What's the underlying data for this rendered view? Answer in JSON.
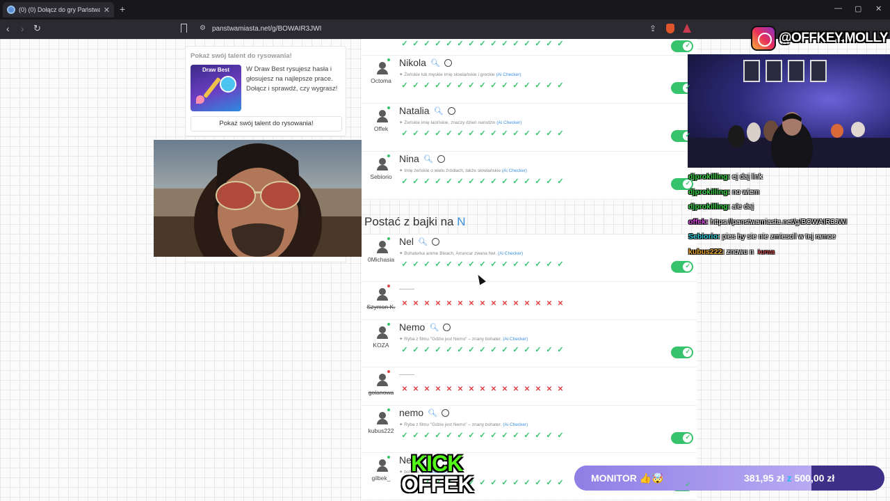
{
  "browser": {
    "tab_title": "(0) (0) Dołącz do gry Państwa M",
    "tab_close": "✕",
    "new_tab": "+",
    "url": "panstwamiasta.net/g/BOWAIR3JWI",
    "window_controls": [
      "—",
      "▢",
      "✕"
    ]
  },
  "promo": {
    "heading": "Pokaż swój talent do rysowania!",
    "tile_label": "Draw Best",
    "text": "W Draw Best rysujesz hasła i głosujesz na najlepsze prace. Dołącz i sprawdź, czy wygrasz!",
    "button": "Pokaż swój talent do rysowania!"
  },
  "results_top": [
    {
      "user": "Octoma",
      "answer": "Nikola",
      "desc": "Żeńskie lub męskie imię słowiańskie i greckie",
      "ai": "(Ai Checker)",
      "valid": true
    },
    {
      "user": "Offek",
      "answer": "Natalia",
      "desc": "Żeńskie imię łacińskie, znaczy dzień narodzin",
      "ai": "(Ai Checker)",
      "valid": true
    },
    {
      "user": "Sebiorio",
      "answer": "Nina",
      "desc": "Imię żeńskie o wielu źródłach, także słowiańskie",
      "ai": "(Ai Checker)",
      "valid": true
    }
  ],
  "category": {
    "label": "Postać z bajki na",
    "letter": "N"
  },
  "results_bottom": [
    {
      "user": "0Michasia",
      "answer": "Nel",
      "desc": "Bohaterka anime Bleach, Arrancar zwana Nel.",
      "ai": "(Ai Checker)",
      "valid": true
    },
    {
      "user": "Szymon K.",
      "answer": "",
      "desc": "",
      "ai": "",
      "valid": false
    },
    {
      "user": "KOZA",
      "answer": "Nemo",
      "desc": "Ryba z filmu \"Gdzie jest Nemo\" – znany bohater.",
      "ai": "(Ai Checker)",
      "valid": true
    },
    {
      "user": "golanowa",
      "answer": "",
      "desc": "",
      "ai": "",
      "valid": false
    },
    {
      "user": "kubus222",
      "answer": "nemo",
      "desc": "Ryba z filmu \"Gdzie jest Nemo\" – znany bohater.",
      "ai": "(Ai Checker)",
      "valid": true
    },
    {
      "user": "gilbek_",
      "answer": "Ne",
      "desc": "bohater.",
      "ai": "(Ai Checker)",
      "valid": true
    }
  ],
  "instagram": {
    "handle": "@OFFKEY.MOLLY"
  },
  "chat": [
    {
      "user": "djprokilling:",
      "text": "ej daj link",
      "color": "#3bd44a"
    },
    {
      "user": "djprokilling:",
      "text": "no wiem",
      "color": "#3bd44a"
    },
    {
      "user": "djprokilling:",
      "text": "ale daj",
      "color": "#3bd44a"
    },
    {
      "user": "offek:",
      "text": "https://panstwamiasta.net/g/BOWAIR3JWI",
      "color": "#d14bd9"
    },
    {
      "user": "Sebiorio:",
      "text": "pies by sie nie zmiescil w tej ramce",
      "color": "#2fd0e0"
    },
    {
      "user": "kubus222:",
      "text": "znowu n",
      "color": "#e8a628",
      "extra": "kurwa"
    }
  ],
  "kick": {
    "top": "KICK",
    "bottom": "OFFEK"
  },
  "monitor": {
    "label": "MONITOR 👍🤯",
    "current": "381,95 zł",
    "separator": "z",
    "goal": "500,00 zł",
    "progress": 0.7639
  },
  "colors": {
    "accent": "#3b8fe0",
    "ok": "#33c16b",
    "bad": "#e03c3c",
    "toggle": "#37c36c",
    "kick": "#53fc18"
  },
  "icons": {
    "search": "search-icon",
    "emoji": "emoji-icon",
    "check": "check-icon",
    "cross": "cross-icon"
  }
}
